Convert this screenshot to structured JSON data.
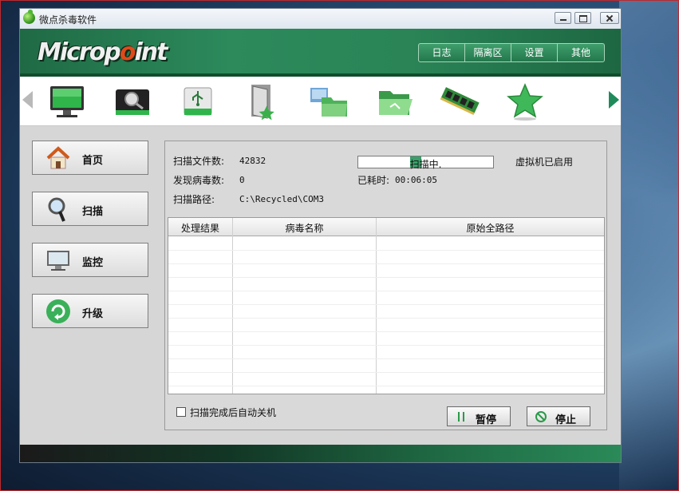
{
  "window": {
    "title": "微点杀毒软件",
    "logo_text_left": "Microp",
    "logo_text_dot": "o",
    "logo_text_right": "int"
  },
  "topnav": [
    "日志",
    "隔离区",
    "设置",
    "其他"
  ],
  "toolbar": {
    "icons": [
      "monitor-icon",
      "disk-search-icon",
      "usb-drive-icon",
      "door-exit-icon",
      "network-folder-icon",
      "open-folder-icon",
      "memory-chip-icon",
      "star-icon"
    ]
  },
  "sidebar": [
    {
      "label": "首页",
      "icon": "home-icon"
    },
    {
      "label": "扫描",
      "icon": "magnifier-icon"
    },
    {
      "label": "监控",
      "icon": "monitor-icon"
    },
    {
      "label": "升级",
      "icon": "refresh-icon"
    }
  ],
  "scan": {
    "files_label": "扫描文件数:",
    "files_value": "42832",
    "virus_label": "发现病毒数:",
    "virus_value": "0",
    "path_label": "扫描路径:",
    "path_value": "C:\\Recycled\\COM3",
    "progress_text": "扫描中.",
    "progress_fraction": 0.55,
    "elapsed_label": "已耗时:",
    "elapsed_value": "00:06:05",
    "vm_status": "虚拟机已启用"
  },
  "table": {
    "columns": [
      "处理结果",
      "病毒名称",
      "原始全路径"
    ],
    "rows": []
  },
  "footer": {
    "auto_shutdown_label": "扫描完成后自动关机",
    "auto_shutdown_checked": false,
    "pause_label": "暂停",
    "stop_label": "停止"
  },
  "colors": {
    "brand_green": "#2c8a5b",
    "progress_fill": "#3aa06a"
  }
}
